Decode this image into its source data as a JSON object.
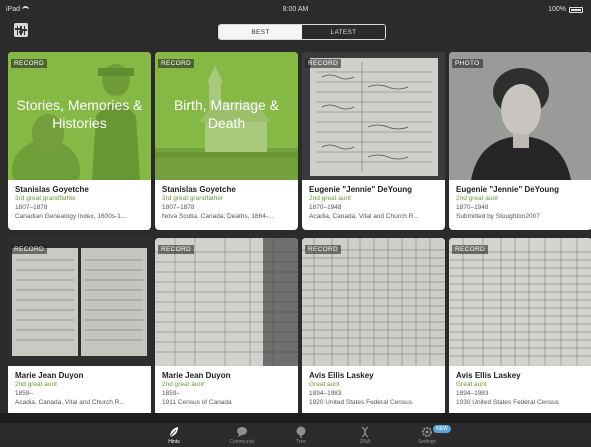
{
  "status": {
    "device": "iPad",
    "time": "8:00 AM",
    "battery": "100%"
  },
  "tabs_top": {
    "best": "BEST",
    "latest": "LATEST"
  },
  "cards": [
    {
      "tag": "RECORD",
      "overlay": "Stories, Memories & Histories",
      "name": "Stanislas Goyetche",
      "relation": "3rd great grandfather",
      "years": "1807–1878",
      "source": "Canadian Genealogy Index, 1600s-1..."
    },
    {
      "tag": "RECORD",
      "overlay": "Birth, Marriage & Death",
      "name": "Stanislas Goyetche",
      "relation": "3rd great grandfather",
      "years": "1807–1878",
      "source": "Nova Scotia, Canada, Deaths, 1864-..."
    },
    {
      "tag": "RECORD",
      "overlay": "",
      "name": "Eugenie \"Jennie\" DeYoung",
      "relation": "2nd great aunt",
      "years": "1870–1948",
      "source": "Acadia, Canada, Vital and Church R..."
    },
    {
      "tag": "PHOTO",
      "overlay": "",
      "name": "Eugenie \"Jennie\" DeYoung",
      "relation": "2nd great aunt",
      "years": "1870–1948",
      "source": "Submitted by Stoughton2007"
    },
    {
      "tag": "RECORD",
      "overlay": "",
      "name": "Marie Jean Duyon",
      "relation": "2nd great aunt",
      "years": "1859–",
      "source": "Acadia, Canada, Vital and Church R..."
    },
    {
      "tag": "RECORD",
      "overlay": "",
      "name": "Marie Jean Duyon",
      "relation": "2nd great aunt",
      "years": "1859–",
      "source": "1911 Census of Canada"
    },
    {
      "tag": "RECORD",
      "overlay": "",
      "name": "Avis Ellis Laskey",
      "relation": "Great aunt",
      "years": "1894–1983",
      "source": "1920 United States Federal Census"
    },
    {
      "tag": "RECORD",
      "overlay": "",
      "name": "Avis Ellis Laskey",
      "relation": "Great aunt",
      "years": "1894–1983",
      "source": "1930 United States Federal Census"
    }
  ],
  "tabbar": {
    "hints": "Hints",
    "community": "Community",
    "tree": "Tree",
    "dna": "DNA",
    "settings": "Settings",
    "badge": "NEW"
  }
}
